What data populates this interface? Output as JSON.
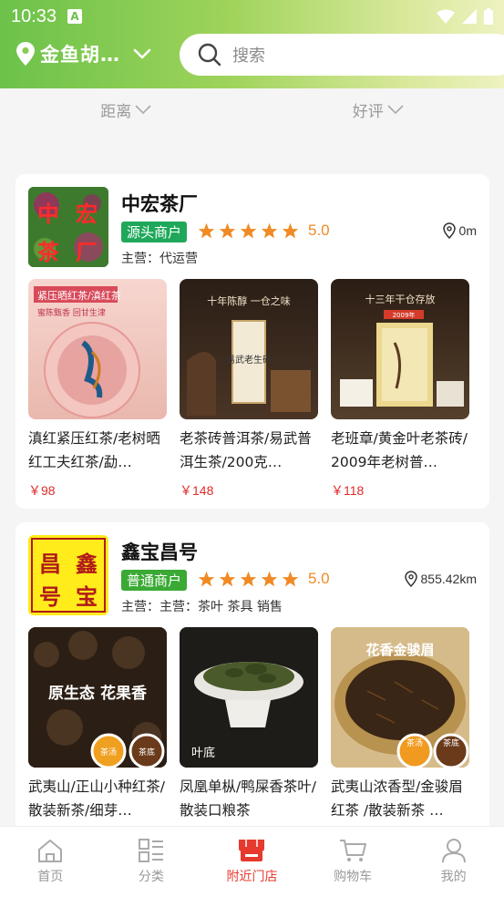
{
  "status": {
    "time": "10:33",
    "app_icon_letter": "A"
  },
  "header": {
    "location": "金鱼胡…",
    "search_placeholder": "搜索"
  },
  "filters": [
    {
      "label": "距离"
    },
    {
      "label": "好评"
    }
  ],
  "shops": [
    {
      "name": "中宏茶厂",
      "logo_text": [
        "中",
        "宏",
        "茶",
        "厂"
      ],
      "badge": "源头商户",
      "rating": "5.0",
      "distance": "0m",
      "main_business": "主营：代运营",
      "products": [
        {
          "title": "滇红紧压红茶/老树晒红工夫红茶/勐…",
          "price": "￥98",
          "img_caption": "紧压晒红茶/滇红茶",
          "img_sub": "蜜陈甄香 回甘生津"
        },
        {
          "title": "老茶砖普洱茶/易武普洱生茶/200克…",
          "price": "￥148",
          "img_caption": "十年陈醇 一仓之味",
          "img_sub": "易武老生砖"
        },
        {
          "title": "老班章/黄金叶老茶砖/ 2009年老树普…",
          "price": "￥118",
          "img_caption": "十三年干仓存放",
          "img_sub": "2009年"
        }
      ]
    },
    {
      "name": "鑫宝昌号",
      "logo_text": [
        "昌",
        "鑫",
        "号",
        "宝"
      ],
      "badge": "普通商户",
      "rating": "5.0",
      "distance": "855.42km",
      "main_business": "主营：主营：茶叶 茶具 销售",
      "products": [
        {
          "title": "武夷山/正山小种红茶/散装新茶/细芽…",
          "price": "",
          "img_caption": "原生态 花果香",
          "img_sub": [
            "茶汤",
            "茶底"
          ]
        },
        {
          "title": "凤凰单枞/鸭屎香茶叶/散装口粮茶",
          "price": "",
          "img_caption": "叶底",
          "img_sub": []
        },
        {
          "title": "武夷山浓香型/金骏眉红茶 /散装新茶 …",
          "price": "",
          "img_caption": "花香金骏眉",
          "img_sub": [
            "茶汤",
            "茶底"
          ]
        }
      ]
    }
  ],
  "tabbar": [
    {
      "label": "首页",
      "icon": "home-icon"
    },
    {
      "label": "分类",
      "icon": "category-icon"
    },
    {
      "label": "附近门店",
      "icon": "store-icon",
      "active": true
    },
    {
      "label": "购物车",
      "icon": "cart-icon"
    },
    {
      "label": "我的",
      "icon": "user-icon"
    }
  ],
  "colors": {
    "accent": "#e63a2f",
    "header_green": "#6cc24a",
    "star": "#f08a24",
    "price": "#e02b2b"
  }
}
